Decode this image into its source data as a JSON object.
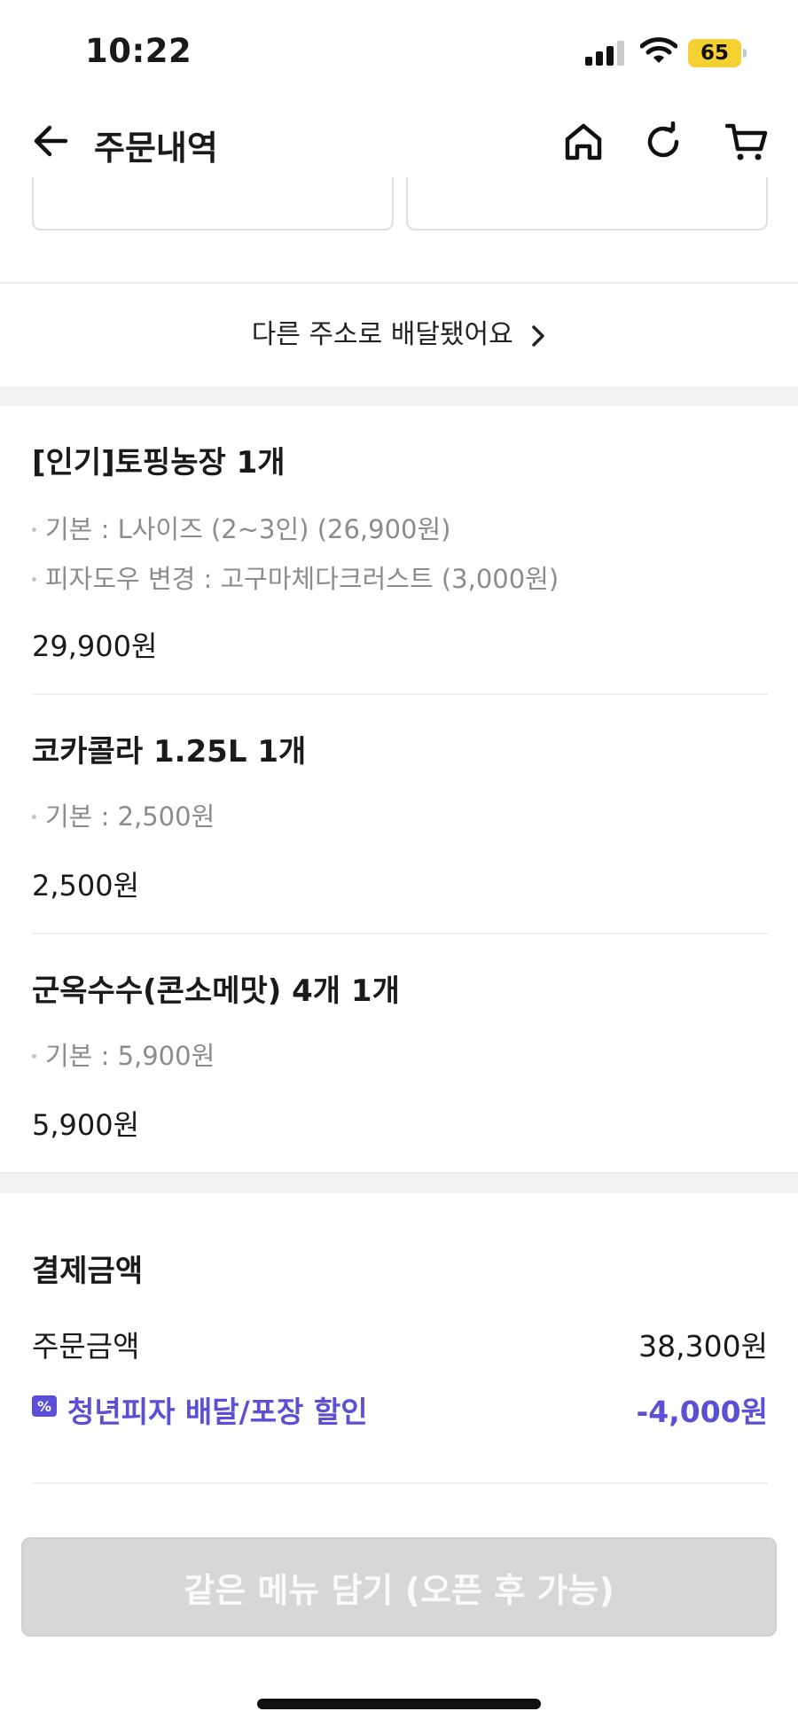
{
  "status_bar": {
    "time": "10:22",
    "battery": "65"
  },
  "header": {
    "title": "주문내역"
  },
  "other_address_link": "다른 주소로 배달됐어요",
  "order_items": [
    {
      "name": "[인기]토핑농장 1개",
      "options": [
        "기본 : L사이즈 (2~3인) (26,900원)",
        "피자도우 변경 : 고구마체다크러스트 (3,000원)"
      ],
      "price": "29,900원"
    },
    {
      "name": "코카콜라 1.25L 1개",
      "options": [
        "기본 : 2,500원"
      ],
      "price": "2,500원"
    },
    {
      "name": "군옥수수(콘소메맛) 4개 1개",
      "options": [
        "기본 : 5,900원"
      ],
      "price": "5,900원"
    }
  ],
  "payment": {
    "title": "결제금액",
    "order_amount_label": "주문금액",
    "order_amount": "38,300원",
    "discount_label": "청년피자 배달/포장 할인",
    "discount_amount": "-4,000원"
  },
  "cta": {
    "label": "같은 메뉴 담기 (오픈 후 가능)"
  },
  "colors": {
    "accent": "#5b4fd6",
    "battery": "#f5d033",
    "cta_disabled": "#d7d7d9"
  }
}
